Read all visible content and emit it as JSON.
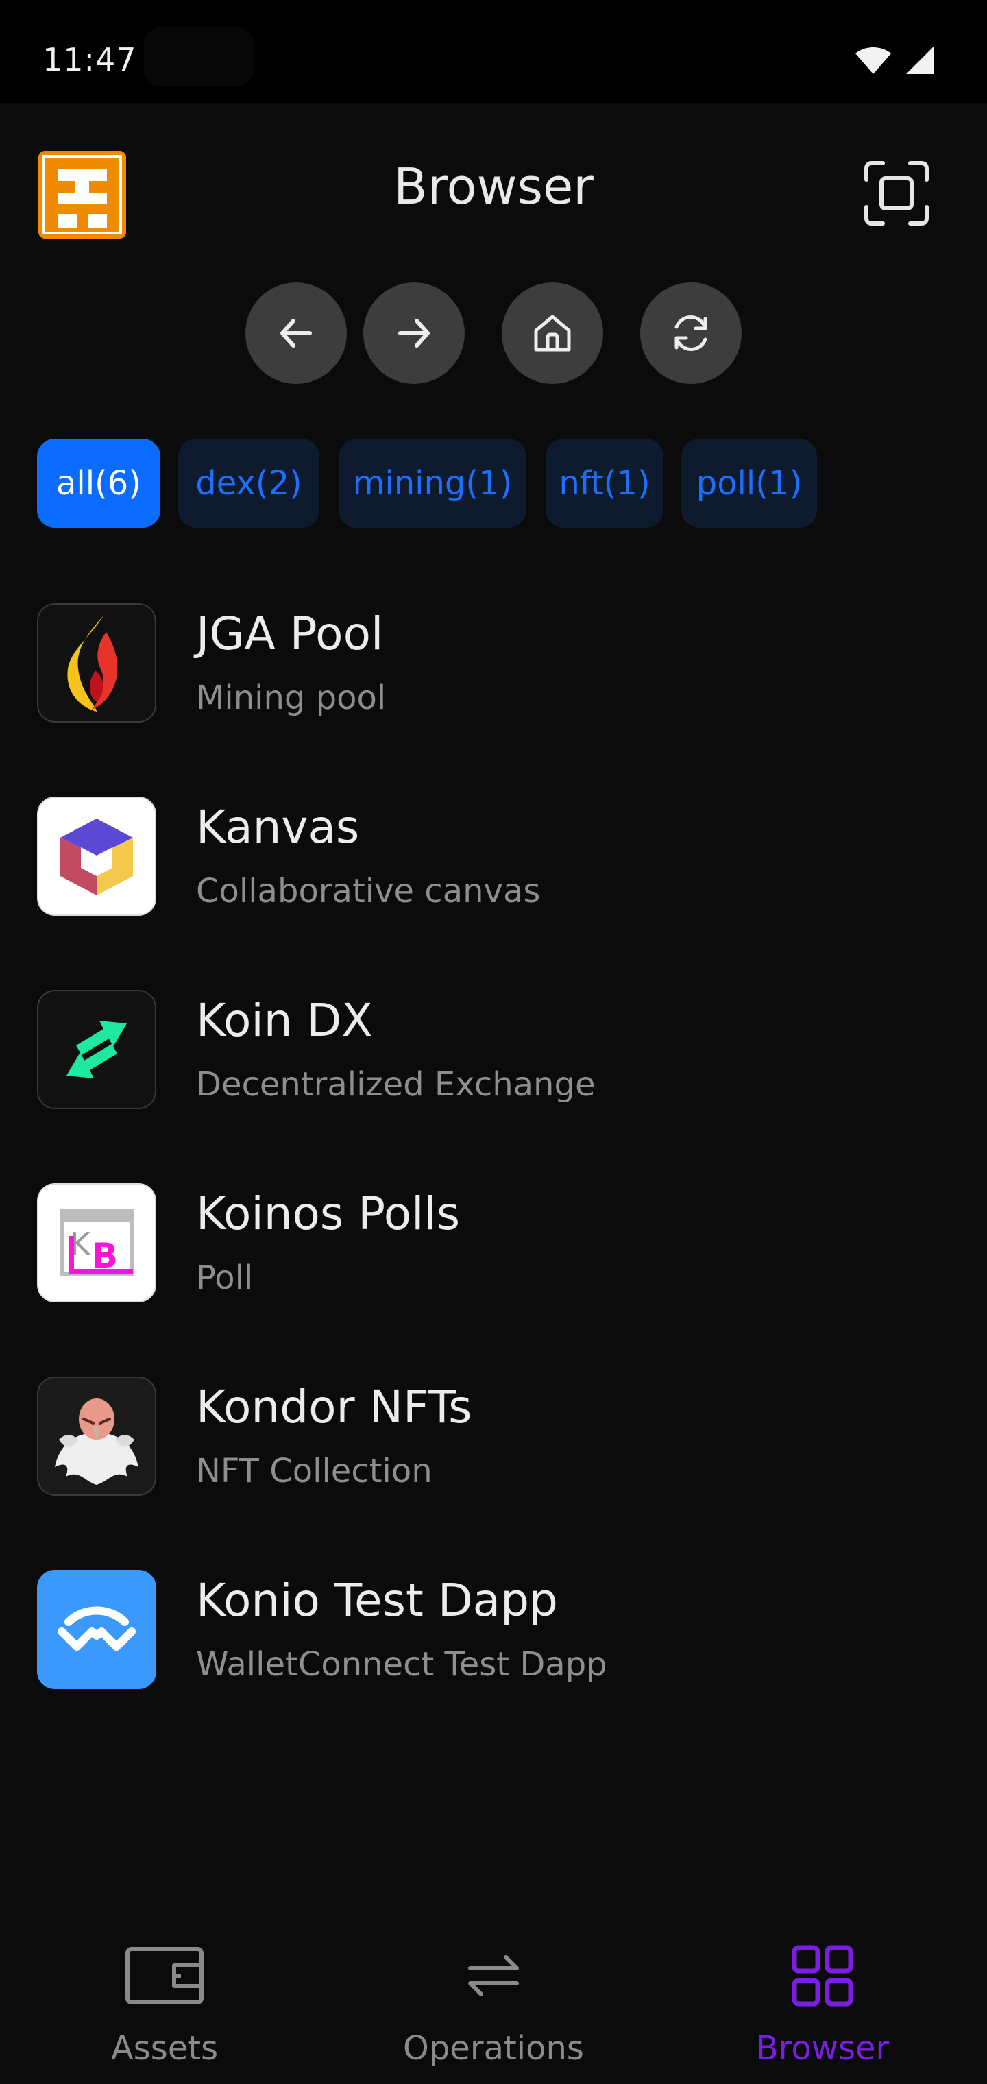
{
  "status_bar": {
    "time": "11:47"
  },
  "header": {
    "title": "Browser"
  },
  "filters": [
    {
      "label": "all(6)",
      "active": true
    },
    {
      "label": "dex(2)",
      "active": false
    },
    {
      "label": "mining(1)",
      "active": false
    },
    {
      "label": "nft(1)",
      "active": false
    },
    {
      "label": "poll(1)",
      "active": false
    }
  ],
  "dapps": [
    {
      "name": "JGA Pool",
      "description": "Mining pool",
      "icon": "flame-icon"
    },
    {
      "name": "Kanvas",
      "description": "Collaborative canvas",
      "icon": "cube-icon"
    },
    {
      "name": "Koin DX",
      "description": "Decentralized Exchange",
      "icon": "swap-arrows-icon"
    },
    {
      "name": "Koinos Polls",
      "description": "Poll",
      "icon": "kb-logo-icon"
    },
    {
      "name": "Kondor NFTs",
      "description": "NFT Collection",
      "icon": "condor-icon"
    },
    {
      "name": "Konio Test Dapp",
      "description": "WalletConnect Test Dapp",
      "icon": "walletconnect-icon"
    }
  ],
  "bottom_nav": [
    {
      "label": "Assets",
      "icon": "wallet-icon",
      "active": false
    },
    {
      "label": "Operations",
      "icon": "transfer-arrows-icon",
      "active": false
    },
    {
      "label": "Browser",
      "icon": "grid-icon",
      "active": true
    }
  ],
  "colors": {
    "accent": "#0b6cff",
    "active_nav": "#7a1fe0",
    "background": "#0b0b0b"
  }
}
